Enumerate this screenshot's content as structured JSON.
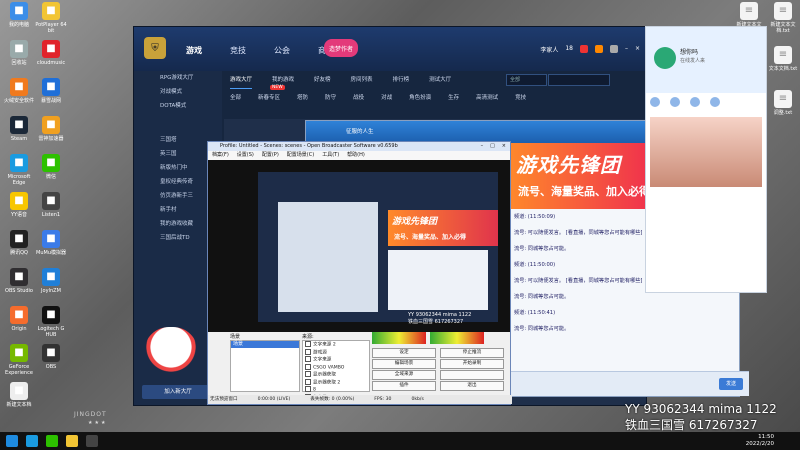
{
  "desktop": {
    "icons": [
      {
        "label": "我的电脑",
        "color": "#3c8ee8"
      },
      {
        "label": "PotPlayer 64 bit",
        "color": "#f2c534"
      },
      {
        "label": "回收站",
        "color": "#9aa"
      },
      {
        "label": "cloudmusic",
        "color": "#e0242b"
      },
      {
        "label": "火绒安全软件",
        "color": "#f07a1e"
      },
      {
        "label": "暴雪战网",
        "color": "#1f6fd8"
      },
      {
        "label": "Steam",
        "color": "#1b2838"
      },
      {
        "label": "雷神加速器",
        "color": "#f0a020"
      },
      {
        "label": "Microsoft Edge",
        "color": "#1a9be0"
      },
      {
        "label": "微信",
        "color": "#2dc100"
      },
      {
        "label": "YY语音",
        "color": "#f7c600"
      },
      {
        "label": "Listen1",
        "color": "#444"
      },
      {
        "label": "腾讯QQ",
        "color": "#222"
      },
      {
        "label": "MuMu模拟器",
        "color": "#3b7be8"
      },
      {
        "label": "OBS Studio",
        "color": "#302e31"
      },
      {
        "label": "JoyInZM",
        "color": "#1f7fd8"
      },
      {
        "label": "Origin",
        "color": "#f56c2d"
      },
      {
        "label": "Logitech G HUB",
        "color": "#111"
      },
      {
        "label": "GeForce Experience",
        "color": "#76b900"
      },
      {
        "label": "OBS",
        "color": "#333"
      },
      {
        "label": "新建文本档",
        "color": "#eee"
      }
    ],
    "right_files": [
      {
        "label": "新建文本文档.txt"
      },
      {
        "label": "新建文本文档.txt"
      },
      {
        "label": "设置.txt"
      },
      {
        "label": "文本文档.txt"
      },
      {
        "label": "截图.txt"
      },
      {
        "label": "调整.txt"
      }
    ]
  },
  "lobby": {
    "nav": [
      "游戏",
      "竞技",
      "公会",
      "商城"
    ],
    "promo": "造梦作者",
    "user": "李家人",
    "level": "18",
    "sidebar": [
      "RPG游戏大厅",
      "对战模式",
      "DOTA模式",
      "三国塔",
      "英三国",
      "新版热门中",
      "皇权经典传奇",
      "仿页游新手三",
      "新手村",
      "我的游戏收藏",
      "三国后战TD"
    ],
    "add_room": "加入新大厅",
    "subtabs": [
      "游戏大厅",
      "我的游戏",
      "好友榜",
      "房间列表",
      "排行榜",
      "测试大厅"
    ],
    "search_placeholder": "全部",
    "cattabs": [
      "全部",
      "新春专区",
      "塔防",
      "防守",
      "战役",
      "对战",
      "角色扮演",
      "生存",
      "高清测试",
      "竞技"
    ],
    "new_badge": "NEW"
  },
  "gamewin": {
    "title": "征服的人生",
    "banner_main": "游戏先锋团",
    "banner_sub": "流号、海量奖品、加入必得",
    "messages": [
      "频道: (11:50:09)",
      "流号: 可以随便发言。 [看直播，同城等您占可能有哪些]",
      "流号: 同城等您占可能。",
      "频道: (11:50:00)",
      "流号: 可以随便发言。 [看直播，同城等您占可能有哪些]",
      "流号: 同城等您占可能。",
      "频道: (11:50:41)",
      "流号: 同城等您占可能。"
    ],
    "send": "发送"
  },
  "qq": {
    "name": "想你吗",
    "status": "在线发人来"
  },
  "obs": {
    "title": "Profile: Untitled - Scenes: scenes - Open Broadcaster Software v0.659b",
    "menu": [
      "档案(F)",
      "设置(S)",
      "配置(P)",
      "配置场景(C)",
      "工具(T)",
      "帮助(H)"
    ],
    "scenes_label": "场景",
    "sources_label": "来源:",
    "scene_selected": "场景",
    "sources": [
      "文字来源 2",
      "游戏源",
      "文字来源",
      "CSGO VAMBO",
      "显示器获取",
      "显示器获取 2",
      "8",
      "名人堂"
    ],
    "buttons": [
      "设定",
      "停止推流",
      "编辑场景",
      "开始录制",
      "全域来源",
      "",
      "插件",
      "退出"
    ],
    "overlay_yy": "YY 93062344 mima 1122",
    "overlay_name": "铁血三国雪 617267327",
    "status": [
      "无法预览窗口",
      "0:00:00 (LIVE)",
      "丢失帧数: 0 (0.00%)",
      "FPS: 30",
      "0kb/s"
    ]
  },
  "overlay": {
    "yy": "YY  93062344  mima 1122",
    "name": "铁血三国雪  617267327",
    "jingdot": "JINGDOT",
    "stars": "★★★"
  },
  "taskbar": {
    "time": "11:50",
    "date": "2022/2/20"
  }
}
